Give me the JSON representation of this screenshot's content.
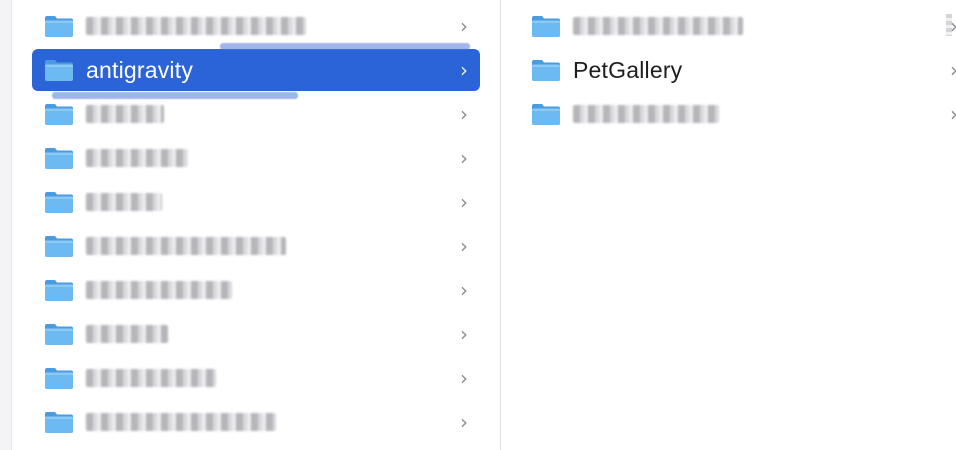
{
  "left_column": {
    "rows": [
      {
        "name": "",
        "blurred": true,
        "blur_width": 220
      },
      {
        "name": "antigravity",
        "blurred": false,
        "selected": true
      },
      {
        "name": "",
        "blurred": true,
        "blur_width": 78
      },
      {
        "name": "",
        "blurred": true,
        "blur_width": 102
      },
      {
        "name": "",
        "blurred": true,
        "blur_width": 76
      },
      {
        "name": "",
        "blurred": true,
        "blur_width": 200
      },
      {
        "name": "",
        "blurred": true,
        "blur_width": 146
      },
      {
        "name": "",
        "blurred": true,
        "blur_width": 82
      },
      {
        "name": "",
        "blurred": true,
        "blur_width": 130
      },
      {
        "name": "",
        "blurred": true,
        "blur_width": 190
      }
    ],
    "chevron": "›"
  },
  "right_column": {
    "rows": [
      {
        "name": "",
        "blurred": true,
        "blur_width": 170
      },
      {
        "name": "PetGallery",
        "blurred": false,
        "selected": false
      },
      {
        "name": "",
        "blurred": true,
        "blur_width": 146
      }
    ],
    "chevron": "›"
  },
  "colors": {
    "selection": "#2b64d6",
    "folder_fill": "#63b3f0",
    "folder_tab": "#4a9be0",
    "text": "#1d1d1f",
    "chevron": "#8e8e93"
  },
  "icons": {
    "folder": "folder-icon",
    "chevron": "chevron-right-icon"
  }
}
